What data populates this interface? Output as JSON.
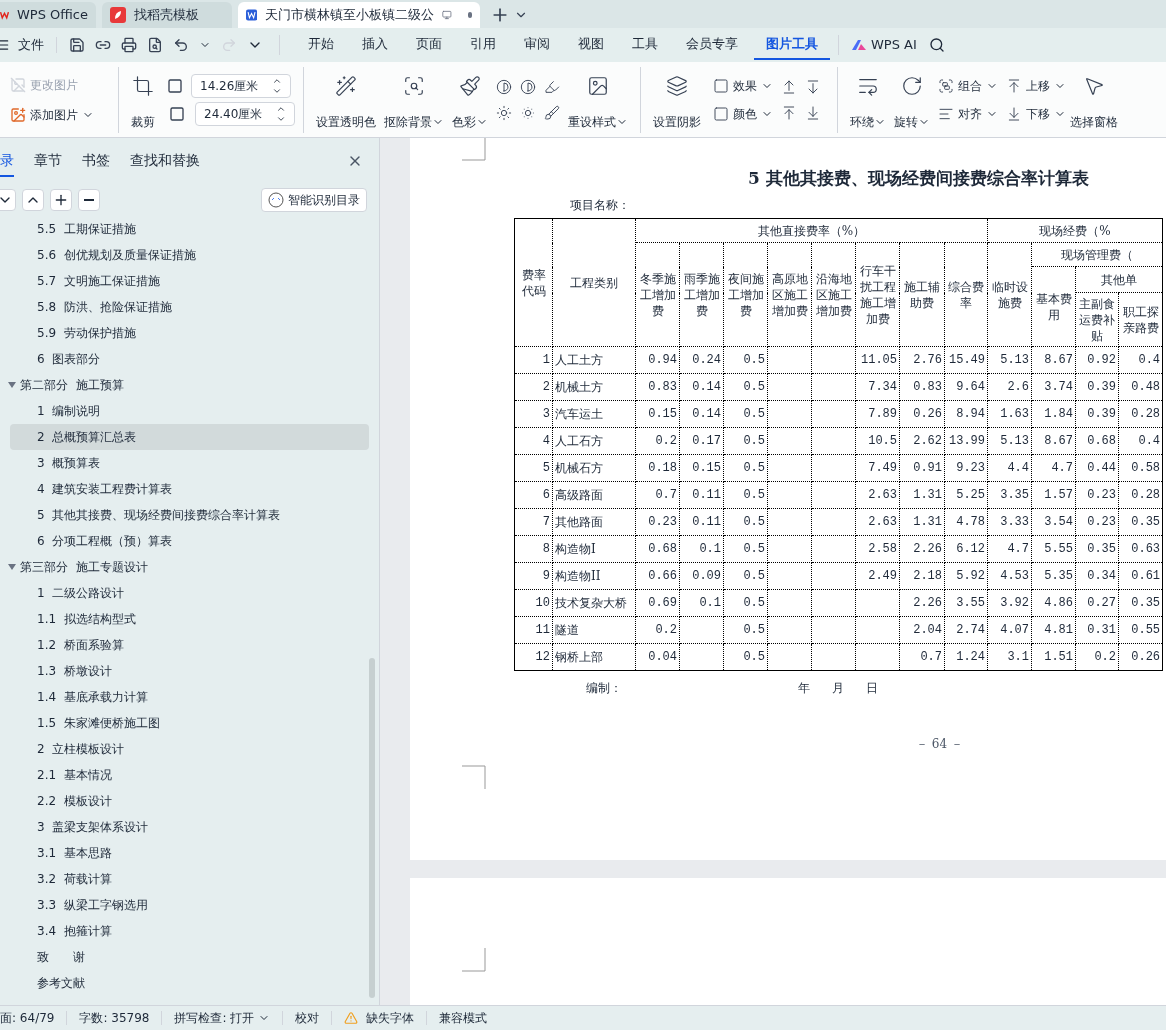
{
  "app_tabs": [
    {
      "kind": "home",
      "label": "WPS Office",
      "selected": false
    },
    {
      "kind": "template",
      "label": "找稻壳模板",
      "selected": false
    },
    {
      "kind": "document",
      "label": "天门市横林镇至小板镇二级公",
      "selected": true
    }
  ],
  "menu": {
    "file": "文件",
    "tabs": [
      {
        "label": "开始",
        "selected": false
      },
      {
        "label": "插入",
        "selected": false
      },
      {
        "label": "页面",
        "selected": false
      },
      {
        "label": "引用",
        "selected": false
      },
      {
        "label": "审阅",
        "selected": false
      },
      {
        "label": "视图",
        "selected": false
      },
      {
        "label": "工具",
        "selected": false
      },
      {
        "label": "会员专享",
        "selected": false
      },
      {
        "label": "图片工具",
        "selected": true
      }
    ],
    "ai": "WPS AI"
  },
  "ribbon": {
    "change_picture": {
      "label": "更改图片",
      "disabled": true
    },
    "add_picture": {
      "label": "添加图片",
      "disabled": false
    },
    "crop": "裁剪",
    "width": "14.26厘米",
    "height": "24.40厘米",
    "transparent": "设置透明色",
    "remove_bg": "抠除背景",
    "color_mode": "色彩",
    "reset_style": "重设样式",
    "shadow": "设置阴影",
    "effect": "效果",
    "shadow_color": "颜色",
    "wrap": "环绕",
    "rotate": "旋转",
    "group": "组合",
    "align": "对齐",
    "move_up": "上移",
    "move_down": "下移",
    "pane": "选择窗格"
  },
  "sidebar": {
    "tabs": [
      {
        "label": "录",
        "selected": true
      },
      {
        "label": "章节",
        "selected": false
      },
      {
        "label": "书签",
        "selected": false
      },
      {
        "label": "查找和替换",
        "selected": false
      }
    ],
    "smart_button": "智能识别目录",
    "outline": [
      {
        "label": "5.5  工期保证措施",
        "selected": false
      },
      {
        "label": "5.6  创优规划及质量保证措施",
        "selected": false
      },
      {
        "label": "5.7  文明施工保证措施",
        "selected": false
      },
      {
        "label": "5.8  防洪、抢险保证措施",
        "selected": false
      },
      {
        "label": "5.9  劳动保护措施",
        "selected": false
      },
      {
        "label": "6  图表部分",
        "selected": false
      },
      {
        "label": "第二部分  施工预算",
        "selected": false,
        "expanded": true,
        "children": [
          {
            "label": "1  编制说明",
            "selected": false
          },
          {
            "label": "2  总概预算汇总表",
            "selected": true
          },
          {
            "label": "3  概预算表",
            "selected": false
          },
          {
            "label": "4  建筑安装工程费计算表",
            "selected": false
          },
          {
            "label": "5  其他其接费、现场经费间接费综合率计算表",
            "selected": false
          },
          {
            "label": "6  分项工程概（预）算表",
            "selected": false
          }
        ]
      },
      {
        "label": "第三部分  施工专题设计",
        "selected": false,
        "expanded": true,
        "children": [
          {
            "label": "1  二级公路设计",
            "selected": false
          },
          {
            "label": "1.1  拟选结构型式",
            "selected": false
          },
          {
            "label": "1.2  桥面系验算",
            "selected": false
          },
          {
            "label": "1.3  桥墩设计",
            "selected": false
          },
          {
            "label": "1.4  基底承载力计算",
            "selected": false
          },
          {
            "label": "1.5  朱家滩便桥施工图",
            "selected": false
          },
          {
            "label": "2  立柱模板设计",
            "selected": false
          },
          {
            "label": "2.1  基本情况",
            "selected": false
          },
          {
            "label": "2.2  模板设计",
            "selected": false
          },
          {
            "label": "3  盖梁支架体系设计",
            "selected": false
          },
          {
            "label": "3.1  基本思路",
            "selected": false
          },
          {
            "label": "3.2  荷载计算",
            "selected": false
          },
          {
            "label": "3.3  纵梁工字钢选用",
            "selected": false
          },
          {
            "label": "3.4  抱箍计算",
            "selected": false
          }
        ]
      },
      {
        "label": "致　　谢",
        "selected": false
      },
      {
        "label": "参考文献",
        "selected": false
      }
    ]
  },
  "document": {
    "title": "5  其他其接费、现场经费间接费综合率计算表",
    "project_label": "项目名称：",
    "table": {
      "header_rows": [
        [
          {
            "label": "费率代码",
            "rowspan": 4
          },
          {
            "label": "工程类别",
            "rowspan": 4
          },
          {
            "label": "其他直接费率（%）",
            "colspan": 8
          },
          {
            "label": "现场经费（%",
            "colspan": 4
          }
        ],
        [
          {
            "label": "冬季施工增加费",
            "rowspan": 3
          },
          {
            "label": "雨季施工增加费",
            "rowspan": 3
          },
          {
            "label": "夜间施工增加费",
            "rowspan": 3
          },
          {
            "label": "高原地区施工增加费",
            "rowspan": 3
          },
          {
            "label": "沿海地区施工增加费",
            "rowspan": 3
          },
          {
            "label": "行车干扰工程施工增加费",
            "rowspan": 3
          },
          {
            "label": "施工辅助费",
            "rowspan": 3
          },
          {
            "label": "综合费率",
            "rowspan": 3
          },
          {
            "label": "临时设施费",
            "rowspan": 3
          },
          {
            "label": "现场管理费（",
            "colspan": 3
          }
        ],
        [
          {
            "label": "基本费用",
            "rowspan": 2
          },
          {
            "label": "其他单",
            "colspan": 2
          }
        ],
        [
          {
            "label": "主副食运费补贴"
          },
          {
            "label": "职工探亲路费"
          }
        ]
      ],
      "rows": [
        {
          "code": "1",
          "category": "人工土方",
          "cells": [
            {
              "kind": "value",
              "text": "0.94"
            },
            {
              "kind": "value",
              "text": "0.24"
            },
            {
              "kind": "value",
              "text": "0.5"
            },
            {
              "kind": "empty"
            },
            {
              "kind": "empty"
            },
            {
              "kind": "value",
              "text": "11.05"
            },
            {
              "kind": "value",
              "text": "2.76"
            },
            {
              "kind": "value",
              "text": "15.49"
            },
            {
              "kind": "value",
              "text": "5.13"
            },
            {
              "kind": "value",
              "text": "8.67"
            },
            {
              "kind": "value",
              "text": "0.92"
            },
            {
              "kind": "value",
              "text": "0.4"
            }
          ]
        },
        {
          "code": "2",
          "category": "机械土方",
          "cells": [
            {
              "kind": "value",
              "text": "0.83"
            },
            {
              "kind": "value",
              "text": "0.14"
            },
            {
              "kind": "value",
              "text": "0.5"
            },
            {
              "kind": "empty"
            },
            {
              "kind": "empty"
            },
            {
              "kind": "value",
              "text": "7.34"
            },
            {
              "kind": "value",
              "text": "0.83"
            },
            {
              "kind": "value",
              "text": "9.64"
            },
            {
              "kind": "value",
              "text": "2.6"
            },
            {
              "kind": "value",
              "text": "3.74"
            },
            {
              "kind": "value",
              "text": "0.39"
            },
            {
              "kind": "value",
              "text": "0.48"
            }
          ]
        },
        {
          "code": "3",
          "category": "汽车运土",
          "cells": [
            {
              "kind": "value",
              "text": "0.15"
            },
            {
              "kind": "value",
              "text": "0.14"
            },
            {
              "kind": "value",
              "text": "0.5"
            },
            {
              "kind": "empty"
            },
            {
              "kind": "empty"
            },
            {
              "kind": "value",
              "text": "7.89"
            },
            {
              "kind": "value",
              "text": "0.26"
            },
            {
              "kind": "value",
              "text": "8.94"
            },
            {
              "kind": "value",
              "text": "1.63"
            },
            {
              "kind": "value",
              "text": "1.84"
            },
            {
              "kind": "value",
              "text": "0.39"
            },
            {
              "kind": "value",
              "text": "0.28"
            }
          ]
        },
        {
          "code": "4",
          "category": "人工石方",
          "cells": [
            {
              "kind": "value",
              "text": "0.2"
            },
            {
              "kind": "value",
              "text": "0.17"
            },
            {
              "kind": "value",
              "text": "0.5"
            },
            {
              "kind": "empty"
            },
            {
              "kind": "empty"
            },
            {
              "kind": "value",
              "text": "10.5"
            },
            {
              "kind": "value",
              "text": "2.62"
            },
            {
              "kind": "value",
              "text": "13.99"
            },
            {
              "kind": "value",
              "text": "5.13"
            },
            {
              "kind": "value",
              "text": "8.67"
            },
            {
              "kind": "value",
              "text": "0.68"
            },
            {
              "kind": "value",
              "text": "0.4"
            }
          ]
        },
        {
          "code": "5",
          "category": "机械石方",
          "cells": [
            {
              "kind": "value",
              "text": "0.18"
            },
            {
              "kind": "value",
              "text": "0.15"
            },
            {
              "kind": "value",
              "text": "0.5"
            },
            {
              "kind": "empty"
            },
            {
              "kind": "empty"
            },
            {
              "kind": "value",
              "text": "7.49"
            },
            {
              "kind": "value",
              "text": "0.91"
            },
            {
              "kind": "value",
              "text": "9.23"
            },
            {
              "kind": "value",
              "text": "4.4"
            },
            {
              "kind": "value",
              "text": "4.7"
            },
            {
              "kind": "value",
              "text": "0.44"
            },
            {
              "kind": "value",
              "text": "0.58"
            }
          ]
        },
        {
          "code": "6",
          "category": "高级路面",
          "cells": [
            {
              "kind": "value",
              "text": "0.7"
            },
            {
              "kind": "value",
              "text": "0.11"
            },
            {
              "kind": "value",
              "text": "0.5"
            },
            {
              "kind": "empty"
            },
            {
              "kind": "empty"
            },
            {
              "kind": "value",
              "text": "2.63"
            },
            {
              "kind": "value",
              "text": "1.31"
            },
            {
              "kind": "value",
              "text": "5.25"
            },
            {
              "kind": "value",
              "text": "3.35"
            },
            {
              "kind": "value",
              "text": "1.57"
            },
            {
              "kind": "value",
              "text": "0.23"
            },
            {
              "kind": "value",
              "text": "0.28"
            }
          ]
        },
        {
          "code": "7",
          "category": "其他路面",
          "cells": [
            {
              "kind": "value",
              "text": "0.23"
            },
            {
              "kind": "value",
              "text": "0.11"
            },
            {
              "kind": "value",
              "text": "0.5"
            },
            {
              "kind": "empty"
            },
            {
              "kind": "empty"
            },
            {
              "kind": "value",
              "text": "2.63"
            },
            {
              "kind": "value",
              "text": "1.31"
            },
            {
              "kind": "value",
              "text": "4.78"
            },
            {
              "kind": "value",
              "text": "3.33"
            },
            {
              "kind": "value",
              "text": "3.54"
            },
            {
              "kind": "value",
              "text": "0.23"
            },
            {
              "kind": "value",
              "text": "0.35"
            }
          ]
        },
        {
          "code": "8",
          "category": "构造物I",
          "cells": [
            {
              "kind": "value",
              "text": "0.68"
            },
            {
              "kind": "value",
              "text": "0.1"
            },
            {
              "kind": "value",
              "text": "0.5"
            },
            {
              "kind": "empty"
            },
            {
              "kind": "empty"
            },
            {
              "kind": "value",
              "text": "2.58"
            },
            {
              "kind": "value",
              "text": "2.26"
            },
            {
              "kind": "value",
              "text": "6.12"
            },
            {
              "kind": "value",
              "text": "4.7"
            },
            {
              "kind": "value",
              "text": "5.55"
            },
            {
              "kind": "value",
              "text": "0.35"
            },
            {
              "kind": "value",
              "text": "0.63"
            }
          ]
        },
        {
          "code": "9",
          "category": "构造物II",
          "cells": [
            {
              "kind": "value",
              "text": "0.66"
            },
            {
              "kind": "value",
              "text": "0.09"
            },
            {
              "kind": "value",
              "text": "0.5"
            },
            {
              "kind": "empty"
            },
            {
              "kind": "empty"
            },
            {
              "kind": "value",
              "text": "2.49"
            },
            {
              "kind": "value",
              "text": "2.18"
            },
            {
              "kind": "value",
              "text": "5.92"
            },
            {
              "kind": "value",
              "text": "4.53"
            },
            {
              "kind": "value",
              "text": "5.35"
            },
            {
              "kind": "value",
              "text": "0.34"
            },
            {
              "kind": "value",
              "text": "0.61"
            }
          ]
        },
        {
          "code": "10",
          "category": "技术复杂大桥",
          "cells": [
            {
              "kind": "value",
              "text": "0.69"
            },
            {
              "kind": "value",
              "text": "0.1"
            },
            {
              "kind": "value",
              "text": "0.5"
            },
            {
              "kind": "empty"
            },
            {
              "kind": "empty"
            },
            {
              "kind": "empty"
            },
            {
              "kind": "value",
              "text": "2.26"
            },
            {
              "kind": "value",
              "text": "3.55"
            },
            {
              "kind": "value",
              "text": "3.92"
            },
            {
              "kind": "value",
              "text": "4.86"
            },
            {
              "kind": "value",
              "text": "0.27"
            },
            {
              "kind": "value",
              "text": "0.35"
            }
          ]
        },
        {
          "code": "11",
          "category": "隧道",
          "cells": [
            {
              "kind": "value",
              "text": "0.2"
            },
            {
              "kind": "empty"
            },
            {
              "kind": "value",
              "text": "0.5"
            },
            {
              "kind": "empty"
            },
            {
              "kind": "empty"
            },
            {
              "kind": "empty"
            },
            {
              "kind": "value",
              "text": "2.04"
            },
            {
              "kind": "value",
              "text": "2.74"
            },
            {
              "kind": "value",
              "text": "4.07"
            },
            {
              "kind": "value",
              "text": "4.81"
            },
            {
              "kind": "value",
              "text": "0.31"
            },
            {
              "kind": "value",
              "text": "0.55"
            }
          ]
        },
        {
          "code": "12",
          "category": "钢桥上部",
          "cells": [
            {
              "kind": "value",
              "text": "0.04"
            },
            {
              "kind": "empty"
            },
            {
              "kind": "value",
              "text": "0.5"
            },
            {
              "kind": "empty"
            },
            {
              "kind": "empty"
            },
            {
              "kind": "empty"
            },
            {
              "kind": "value",
              "text": "0.7"
            },
            {
              "kind": "value",
              "text": "1.24"
            },
            {
              "kind": "value",
              "text": "3.1"
            },
            {
              "kind": "value",
              "text": "1.51"
            },
            {
              "kind": "value",
              "text": "0.2"
            },
            {
              "kind": "value",
              "text": "0.26"
            }
          ]
        }
      ]
    },
    "footer": {
      "prepared_by": "编制：",
      "year": "年",
      "month": "月",
      "day": "日"
    },
    "page_number": "－ 64 －"
  },
  "status_bar": [
    {
      "kind": "text",
      "label": "面: 64/79"
    },
    {
      "kind": "text",
      "label": "字数: 35798"
    },
    {
      "kind": "dropdown",
      "label": "拼写检查: 打开"
    },
    {
      "kind": "text",
      "label": "校对"
    },
    {
      "kind": "warning",
      "label": "缺失字体"
    },
    {
      "kind": "text",
      "label": "兼容模式"
    }
  ]
}
